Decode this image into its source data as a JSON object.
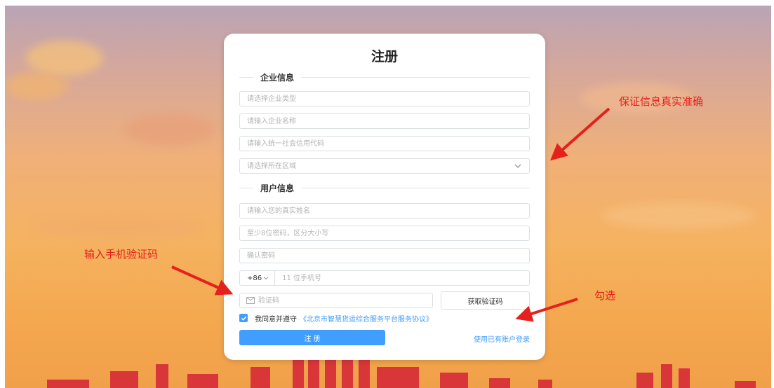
{
  "form": {
    "title": "注册",
    "company_section": "企业信息",
    "user_section": "用户信息",
    "company_type": {
      "placeholder": "请选择企业类型",
      "value": ""
    },
    "company_name": {
      "placeholder": "请输入企业名称",
      "value": ""
    },
    "credit_code": {
      "placeholder": "请输入统一社会信用代码",
      "value": ""
    },
    "region": {
      "placeholder": "请选择所在区域",
      "value": ""
    },
    "real_name": {
      "placeholder": "请输入您的真实姓名",
      "value": ""
    },
    "password": {
      "placeholder": "至少8位密码，区分大小写",
      "value": ""
    },
    "confirm_password": {
      "placeholder": "确认密码",
      "value": ""
    },
    "phone": {
      "prefix": "+86",
      "placeholder": "11 位手机号",
      "value": ""
    },
    "verification_code": {
      "placeholder": "验证码",
      "value": ""
    },
    "get_code_label": "获取验证码",
    "agree": {
      "checked": true,
      "text": "我同意并遵守",
      "link": "《北京市智慧货运综合服务平台服务协议》"
    },
    "submit_label": "注 册",
    "login_link": "使用已有账户登录"
  },
  "annotations": {
    "accuracy": "保证信息真实准确",
    "enter_code": "输入手机验证码",
    "check": "勾选"
  },
  "colors": {
    "primary": "#409eff",
    "annotation": "#e4211c"
  },
  "icons": [
    "chevron-down-icon",
    "mail-icon",
    "check-icon",
    "arrow-icon"
  ]
}
